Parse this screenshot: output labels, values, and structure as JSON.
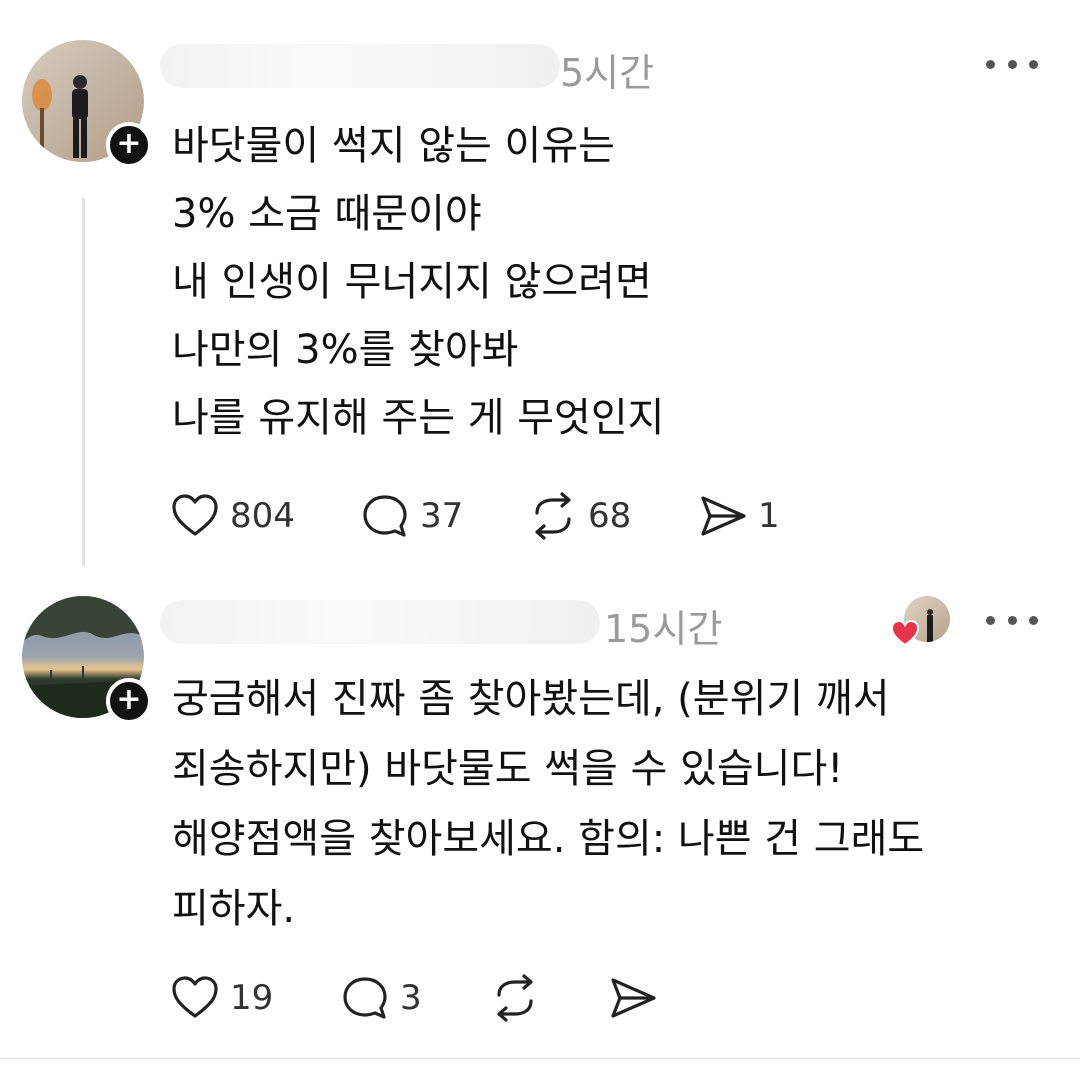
{
  "posts": [
    {
      "timestamp": "5시간",
      "body_lines": [
        "바닷물이 썩지 않는 이유는",
        "3% 소금 때문이야",
        "내 인생이 무너지지 않으려면",
        "나만의 3%를 찾아봐",
        "나를 유지해 주는 게 무엇인지"
      ],
      "actions": {
        "like_count": "804",
        "comment_count": "37",
        "repost_count": "68",
        "share_count": "1"
      },
      "follow_label": "+"
    },
    {
      "timestamp": "15시간",
      "body_lines": [
        "궁금해서 진짜 좀 찾아봤는데, (분위기 깨서",
        "죄송하지만) 바닷물도 썩을 수 있습니다!",
        "해양점액을 찾아보세요. 함의: 나쁜 건 그래도",
        "피하자."
      ],
      "actions": {
        "like_count": "19",
        "comment_count": "3",
        "repost_count": "",
        "share_count": ""
      },
      "follow_label": "+"
    }
  ],
  "icons": {
    "like": "heart-icon",
    "comment": "speech-bubble-icon",
    "repost": "repost-arrows-icon",
    "share": "paper-plane-icon",
    "more": "ellipsis-icon",
    "liked_badge": "red-heart-icon"
  },
  "colors": {
    "text": "#111111",
    "muted": "#9a9a9a",
    "heart_red": "#e8334a"
  }
}
